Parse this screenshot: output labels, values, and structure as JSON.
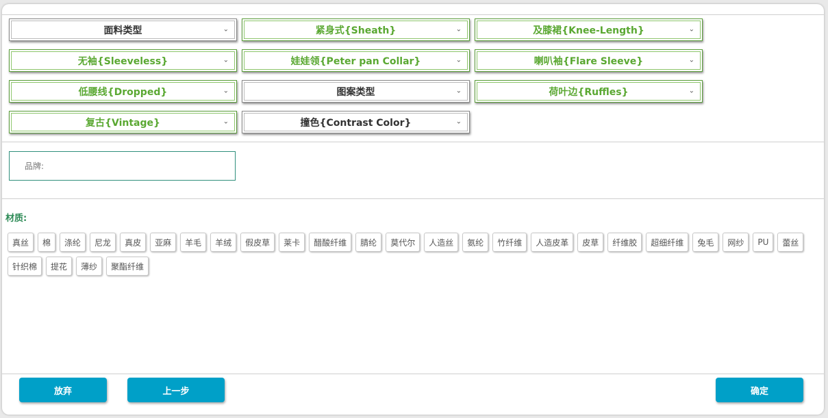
{
  "dropdowns": [
    {
      "label": "面料类型",
      "selected": false
    },
    {
      "label": "紧身式{Sheath}",
      "selected": true
    },
    {
      "label": "及膝裙{Knee-Length}",
      "selected": true
    },
    {
      "label": "无袖{Sleeveless}",
      "selected": true
    },
    {
      "label": "娃娃领{Peter pan Collar}",
      "selected": true
    },
    {
      "label": "喇叭袖{Flare Sleeve}",
      "selected": true
    },
    {
      "label": "低腰线{Dropped}",
      "selected": true
    },
    {
      "label": "图案类型",
      "selected": false
    },
    {
      "label": "荷叶边{Ruffles}",
      "selected": true
    },
    {
      "label": "复古{Vintage}",
      "selected": true
    },
    {
      "label": "撞色{Contrast Color}",
      "selected": false
    }
  ],
  "brand": {
    "placeholder": "品牌:"
  },
  "material": {
    "title": "材质:",
    "tags": [
      "真丝",
      "棉",
      "涤纶",
      "尼龙",
      "真皮",
      "亚麻",
      "羊毛",
      "羊绒",
      "假皮草",
      "莱卡",
      "醋酸纤维",
      "腈纶",
      "莫代尔",
      "人造丝",
      "氨纶",
      "竹纤维",
      "人造皮革",
      "皮草",
      "纤维胶",
      "超细纤维",
      "兔毛",
      "网纱",
      "PU",
      "蕾丝",
      "针织棉",
      "提花",
      "薄纱",
      "聚酯纤维"
    ]
  },
  "footer": {
    "discard": "放弃",
    "back": "上一步",
    "confirm": "确定"
  },
  "colors": {
    "selected_text": "#5aa832",
    "accent": "#00a0c8",
    "material_title": "#2e8b57"
  }
}
